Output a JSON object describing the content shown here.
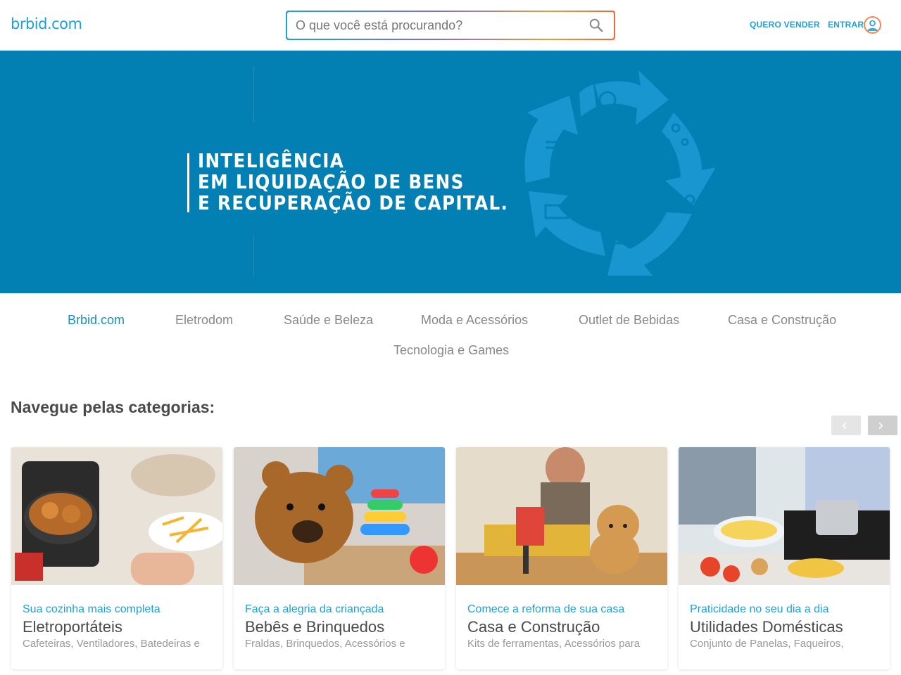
{
  "header": {
    "logo": "brbid.com",
    "search_placeholder": "O que você está procurando?",
    "sell_label": "QUERO VENDER",
    "login_label": "ENTRAR"
  },
  "banner": {
    "line1": "INTELIGÊNCIA",
    "line2": "EM LIQUIDAÇÃO DE BENS",
    "line3": "E RECUPERAÇÃO DE CAPITAL."
  },
  "tabs": [
    {
      "label": "Brbid.com",
      "active": true
    },
    {
      "label": "Eletrodom",
      "active": false
    },
    {
      "label": "Saúde e Beleza",
      "active": false
    },
    {
      "label": "Moda e Acessórios",
      "active": false
    },
    {
      "label": "Outlet de Bebidas",
      "active": false
    },
    {
      "label": "Casa e Construção",
      "active": false
    },
    {
      "label": "Tecnologia e Games",
      "active": false
    }
  ],
  "categories": {
    "title": "Navegue pelas categorias:",
    "cards": [
      {
        "subtitle": "Sua cozinha mais completa",
        "title": "Eletroportáteis",
        "description": "Cafeteiras, Ventiladores, Batedeiras e"
      },
      {
        "subtitle": "Faça a alegria da criançada",
        "title": "Bebês e Brinquedos",
        "description": "Fraldas, Brinquedos, Acessórios e"
      },
      {
        "subtitle": "Comece a reforma de sua casa",
        "title": "Casa e Construção",
        "description": "Kits de ferramentas, Acessórios para"
      },
      {
        "subtitle": "Praticidade no seu dia a dia",
        "title": "Utilidades Domésticas",
        "description": "Conjunto de Panelas, Faqueiros,"
      }
    ]
  },
  "colors": {
    "brand_blue": "#1f9fd6",
    "banner_blue": "#0280b3"
  }
}
